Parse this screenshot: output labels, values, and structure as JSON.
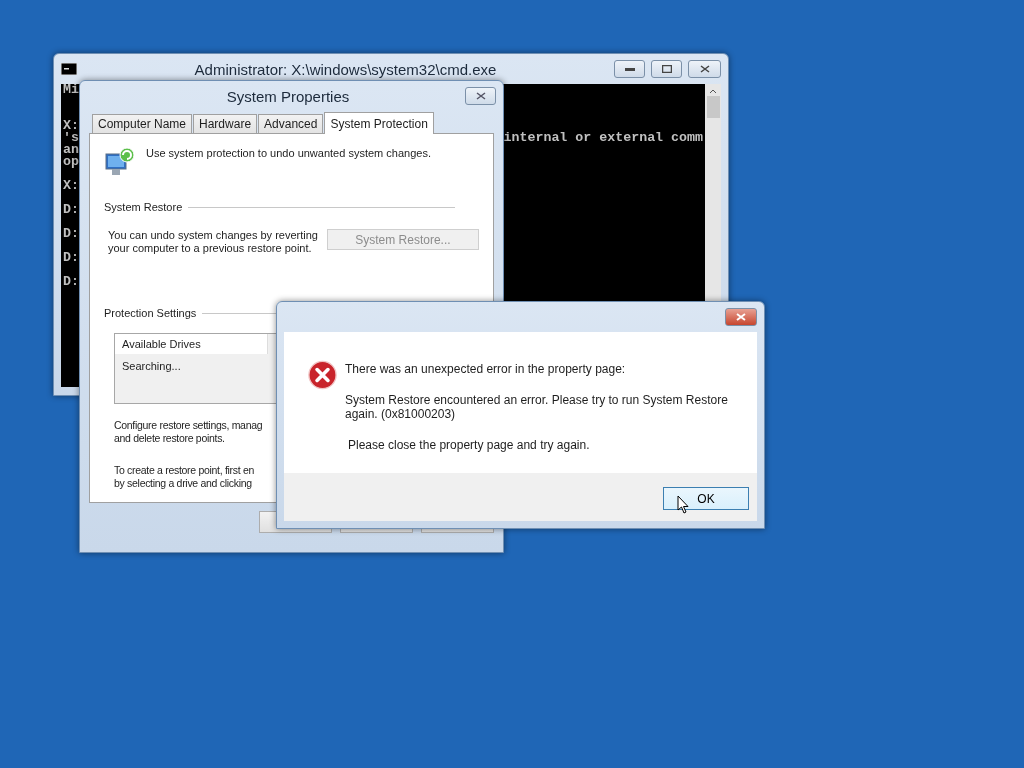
{
  "console_window": {
    "title": "Administrator: X:\\windows\\system32\\cmd.exe",
    "lines": [
      {
        "kind": "text",
        "left": "Mi"
      },
      {
        "kind": "blank"
      },
      {
        "kind": "blank"
      },
      {
        "kind": "text",
        "left": "X:"
      },
      {
        "kind": "text",
        "left": "'s",
        "right": "internal or external comm"
      },
      {
        "kind": "text",
        "left": "an"
      },
      {
        "kind": "text",
        "left": "op"
      },
      {
        "kind": "blank"
      },
      {
        "kind": "text",
        "left": "X:"
      },
      {
        "kind": "blank"
      },
      {
        "kind": "text",
        "left": "D:"
      },
      {
        "kind": "blank"
      },
      {
        "kind": "text",
        "left": "D:"
      },
      {
        "kind": "blank"
      },
      {
        "kind": "text",
        "left": "D:"
      },
      {
        "kind": "blank"
      },
      {
        "kind": "text",
        "left": "D:"
      }
    ]
  },
  "properties_window": {
    "title": "System Properties",
    "tabs": [
      {
        "label": "Computer Name",
        "selected": false
      },
      {
        "label": "Hardware",
        "selected": false
      },
      {
        "label": "Advanced",
        "selected": false
      },
      {
        "label": "System Protection",
        "selected": true
      }
    ],
    "intro": "Use system protection to undo unwanted system changes.",
    "restore_section": {
      "heading": "System Restore",
      "description": "You can undo system changes by reverting your computer to a previous restore point.",
      "button": {
        "label": "System Restore...",
        "disabled": true
      }
    },
    "protection_section": {
      "heading": "Protection Settings",
      "list_header": "Available Drives",
      "list_status": "Searching...",
      "configure_lines": [
        "Configure restore settings, manag",
        "and delete restore points."
      ],
      "create_lines": [
        "To create a restore point, first en",
        "by selecting a drive and clicking"
      ]
    }
  },
  "error_dialog": {
    "heading": "There was an unexpected error in the property page:",
    "detail": "System Restore encountered an error. Please try to run System Restore again. (0x81000203)",
    "hint": "Please close the property page and try again.",
    "button": {
      "label": "OK",
      "focused": true
    }
  }
}
